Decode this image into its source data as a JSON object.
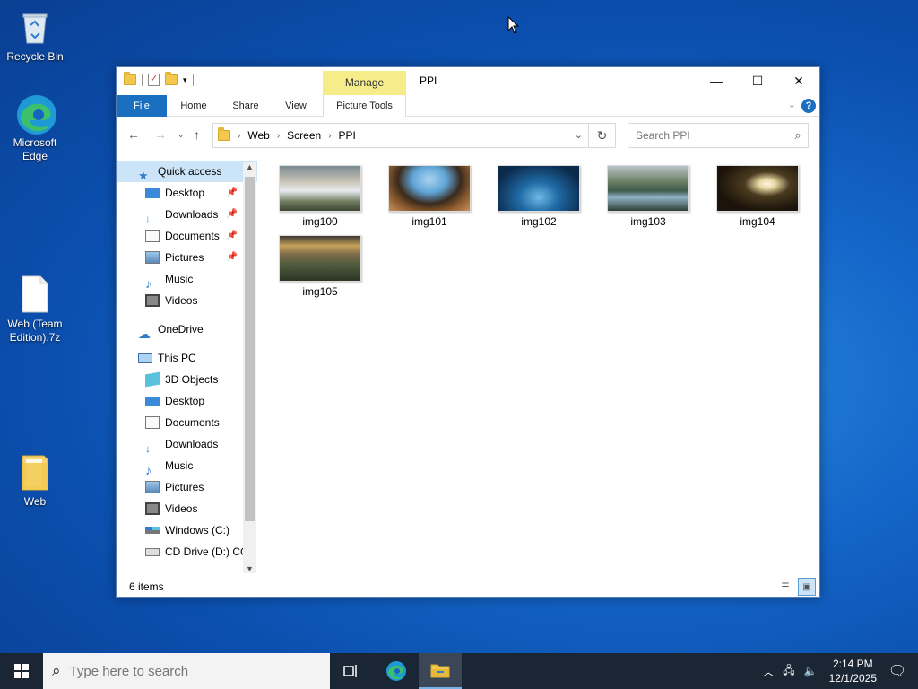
{
  "desktop": {
    "icons": [
      {
        "label": "Recycle Bin"
      },
      {
        "label": "Microsoft Edge"
      },
      {
        "label": "Web (Team Edition).7z"
      },
      {
        "label": "Web"
      }
    ]
  },
  "window": {
    "title": "PPI",
    "manage_tab": "Manage",
    "ribbon_tabs": [
      "File",
      "Home",
      "Share",
      "View",
      "Picture Tools"
    ],
    "breadcrumb": [
      "Web",
      "Screen",
      "PPI"
    ],
    "search_placeholder": "Search PPI",
    "nav": {
      "quick_access": "Quick access",
      "quick_items": [
        "Desktop",
        "Downloads",
        "Documents",
        "Pictures",
        "Music",
        "Videos"
      ],
      "onedrive": "OneDrive",
      "this_pc": "This PC",
      "pc_items": [
        "3D Objects",
        "Desktop",
        "Documents",
        "Downloads",
        "Music",
        "Pictures",
        "Videos",
        "Windows (C:)",
        "CD Drive (D:) CC"
      ]
    },
    "files": [
      "img100",
      "img101",
      "img102",
      "img103",
      "img104",
      "img105"
    ],
    "status_count": "6 items"
  },
  "taskbar": {
    "search_placeholder": "Type here to search",
    "time": "2:14 PM",
    "date": "12/1/2025"
  },
  "colors": {
    "accent": "#1a6fc1",
    "manage_tab": "#f6ec8a",
    "nav_selected": "#cce4f7",
    "taskbar": "#1b2634"
  }
}
